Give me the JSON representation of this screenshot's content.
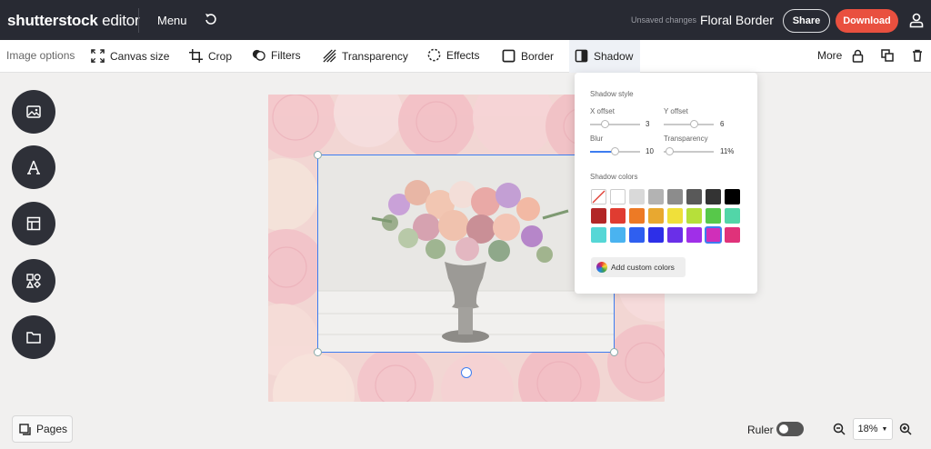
{
  "app": {
    "logo_bold": "shutterstock",
    "logo_rest": " editor",
    "menu_label": "Menu",
    "unsaved_text": "Unsaved changes",
    "document_title": "Floral Border",
    "share_label": "Share",
    "download_label": "Download"
  },
  "toolbar": {
    "image_options": "Image options",
    "canvas_size": "Canvas size",
    "crop": "Crop",
    "filters": "Filters",
    "transparency": "Transparency",
    "effects": "Effects",
    "border": "Border",
    "shadow": "Shadow",
    "more": "More"
  },
  "rail": {
    "items": [
      "image-icon",
      "text-icon",
      "layout-icon",
      "elements-icon",
      "folder-icon"
    ]
  },
  "shadow_panel": {
    "style_title": "Shadow style",
    "x_offset_label": "X offset",
    "x_offset_value": "3",
    "y_offset_label": "Y offset",
    "y_offset_value": "6",
    "blur_label": "Blur",
    "blur_value": "10",
    "transparency_label": "Transparency",
    "transparency_value": "11%",
    "colors_title": "Shadow colors",
    "add_custom_label": "Add custom colors",
    "colors": [
      [
        "none",
        "#ffffff",
        "#d9d9d9",
        "#b3b3b3",
        "#8c8c8c",
        "#595959",
        "#333333",
        "#000000"
      ],
      [
        "#b22727",
        "#e03c31",
        "#ed7a25",
        "#e8a830",
        "#f0e03a",
        "#b6e03a",
        "#57c84a",
        "#52d6a8"
      ],
      [
        "#56d7d6",
        "#4ab3f0",
        "#2f5ff0",
        "#2d2fe8",
        "#6a2fe8",
        "#a02fe8",
        "#d02fb9",
        "#e0327a"
      ]
    ],
    "selected_color": "#d02fb9",
    "x_offset_fraction": 0.3,
    "y_offset_fraction": 0.6,
    "blur_fraction": 0.5,
    "transparency_fraction": 0.11
  },
  "bottom": {
    "pages_label": "Pages",
    "ruler_label": "Ruler",
    "zoom_value": "18%"
  },
  "colors": {
    "topbar": "#282a33",
    "download": "#e9503f",
    "accent": "#3d7df0"
  }
}
